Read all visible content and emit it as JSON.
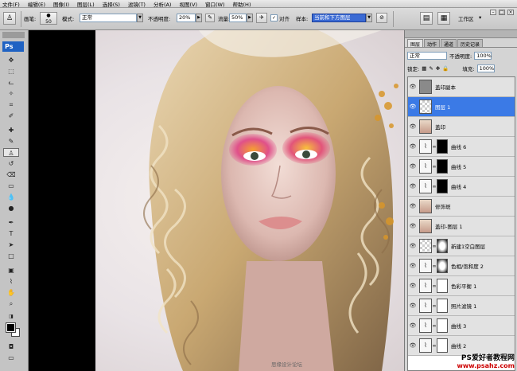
{
  "menu": [
    "文件(F)",
    "编辑(E)",
    "图像(I)",
    "图层(L)",
    "选择(S)",
    "滤镜(T)",
    "分析(A)",
    "视图(V)",
    "窗口(W)",
    "帮助(H)"
  ],
  "options": {
    "brush_label": "画笔:",
    "brush_size": "50",
    "mode_label": "模式:",
    "mode_value": "正常",
    "opacity_label": "不透明度:",
    "opacity_value": "20%",
    "flow_label": "流量:",
    "flow_value": "50%",
    "align_label": "对齐",
    "sample_label": "样本:",
    "sample_value": "当前和下方图层",
    "workspace_label": "工作区"
  },
  "panel": {
    "tabs": [
      "图层",
      "动作",
      "通道",
      "历史记录"
    ],
    "blend_mode": "正常",
    "opacity_label": "不透明度:",
    "opacity_value": "100%",
    "lock_label": "锁定:",
    "fill_label": "填充:",
    "fill_value": "100%",
    "layers": [
      {
        "name": "盖印副本",
        "thumb": "gray"
      },
      {
        "name": "图层 1",
        "thumb": "check",
        "selected": true
      },
      {
        "name": "盖印",
        "thumb": "photo"
      },
      {
        "name": "曲线 6",
        "thumb": "adj",
        "mask": "black"
      },
      {
        "name": "曲线 5",
        "thumb": "adj",
        "mask": "black"
      },
      {
        "name": "曲线 4",
        "thumb": "adj",
        "mask": "black"
      },
      {
        "name": "修饰斑",
        "thumb": "photo"
      },
      {
        "name": "盖印-图层 1",
        "thumb": "photo"
      },
      {
        "name": "新建1空白图层",
        "thumb": "check",
        "mask": "gradw"
      },
      {
        "name": "色相/饱和度 2",
        "thumb": "adj",
        "mask": "gradw"
      },
      {
        "name": "色彩平衡 1",
        "thumb": "adj",
        "mask": "white"
      },
      {
        "name": "照片滤镜 1",
        "thumb": "adj",
        "mask": "white"
      },
      {
        "name": "曲线 3",
        "thumb": "adj",
        "mask": "white"
      },
      {
        "name": "曲线 2",
        "thumb": "adj",
        "mask": "white"
      }
    ]
  },
  "watermark": {
    "line0": "思缘设计论坛",
    "line1": "PS爱好者教程网",
    "line2": "www.psahz.com"
  }
}
